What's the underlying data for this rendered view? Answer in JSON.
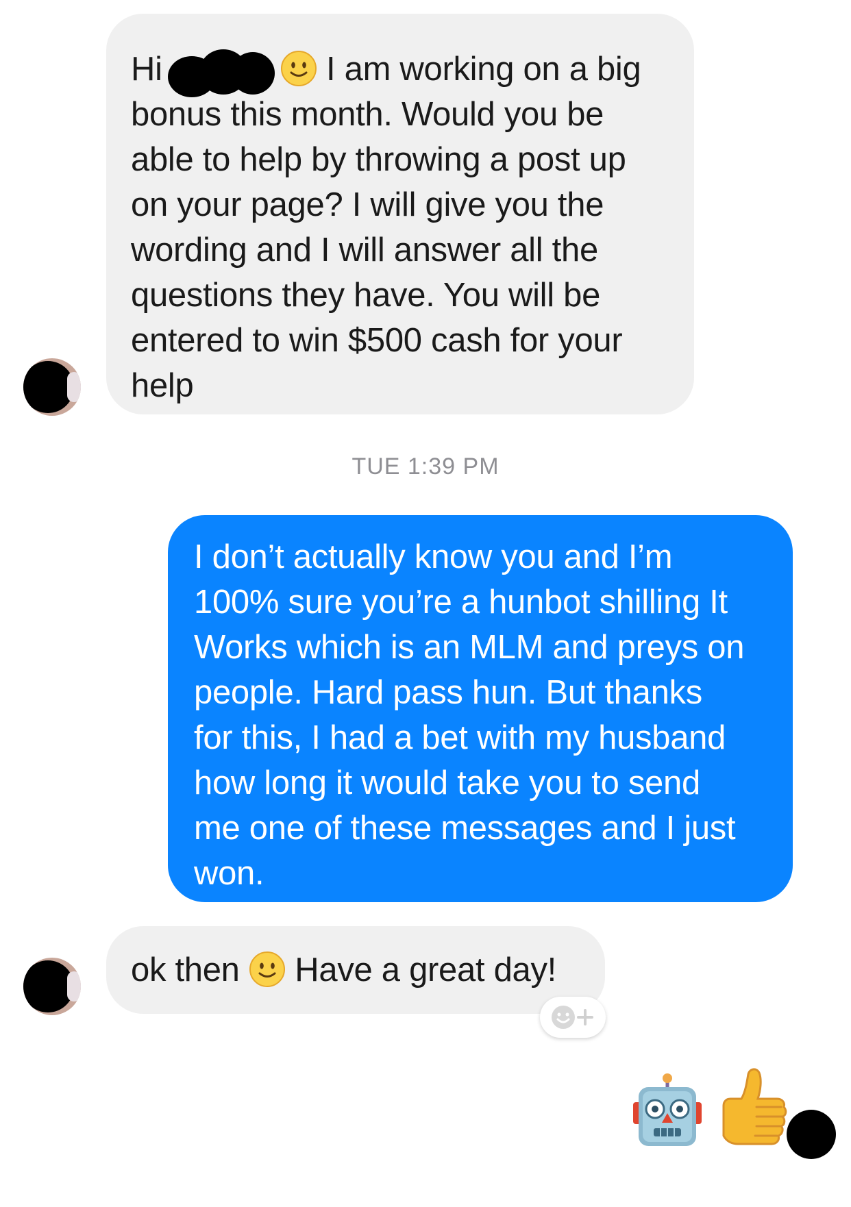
{
  "conversation": {
    "message1": {
      "prefix": "Hi",
      "line1_rest": "I am working on a big",
      "lines": [
        "bonus this month. Would you be",
        "able to help by throwing a post up",
        "on your page? I will give you the",
        "wording and I will answer all the",
        "questions they have. You will be",
        "entered to win $500 cash for your",
        "help"
      ]
    },
    "timestamp": "TUE 1:39 PM",
    "message2": {
      "lines": [
        "I don’t actually know you and I’m",
        "100% sure you’re a hunbot shilling It",
        "Works which is an MLM and preys on",
        "people. Hard pass hun. But thanks",
        "for this, I had a bet with my husband",
        "how long it would take you to send",
        "me one of these messages and I just",
        "won."
      ]
    },
    "message3": {
      "before_emoji": "ok then",
      "after_emoji": "Have a great day!"
    },
    "reaction_button_icon": "add-reaction-icon",
    "sent_emojis": [
      "robot-emoji",
      "thumbs-up-emoji"
    ]
  },
  "colors": {
    "incoming_bubble": "#f0f0f0",
    "outgoing_bubble": "#0a84ff",
    "timestamp": "#8e8e93"
  }
}
